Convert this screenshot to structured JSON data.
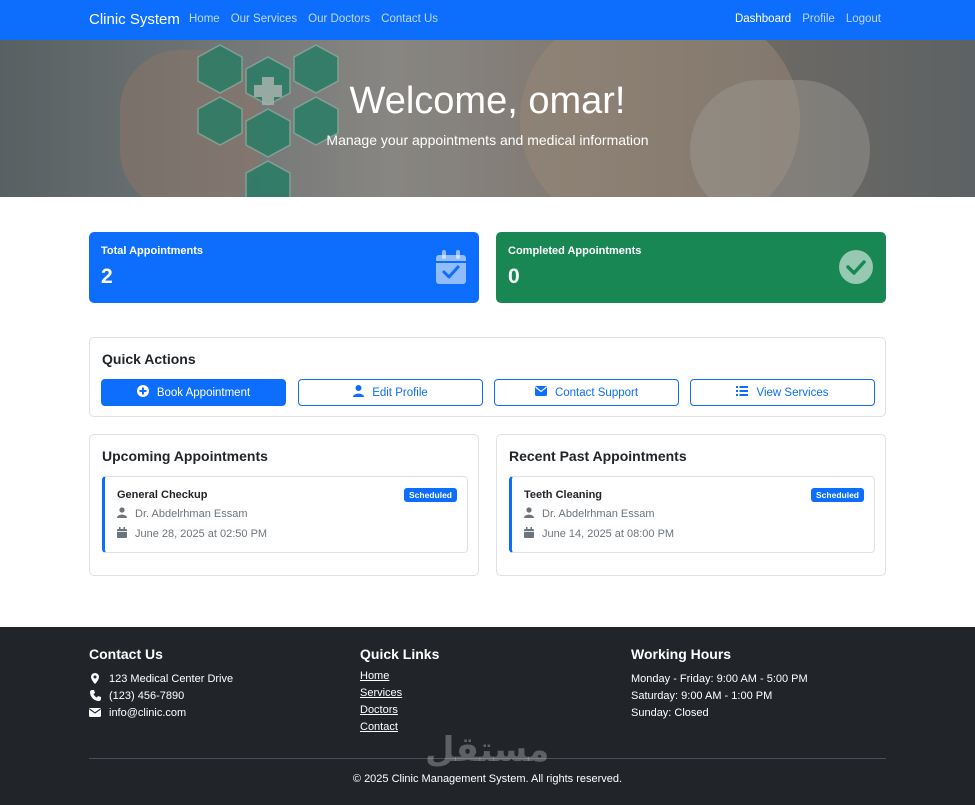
{
  "navbar": {
    "brand": "Clinic System",
    "left_links": [
      "Home",
      "Our Services",
      "Our Doctors",
      "Contact Us"
    ],
    "right_links": [
      "Dashboard",
      "Profile",
      "Logout"
    ],
    "active": "Dashboard"
  },
  "hero": {
    "title": "Welcome, omar!",
    "subtitle": "Manage your appointments and medical information"
  },
  "stats": {
    "total": {
      "label": "Total Appointments",
      "value": "2",
      "icon": "calendar-check-icon",
      "color": "#0d6efd"
    },
    "completed": {
      "label": "Completed Appointments",
      "value": "0",
      "icon": "check-circle-icon",
      "color": "#198754"
    }
  },
  "quick_actions": {
    "title": "Quick Actions",
    "buttons": [
      {
        "label": "Book Appointment",
        "icon": "plus-circle-icon"
      },
      {
        "label": "Edit Profile",
        "icon": "user-icon"
      },
      {
        "label": "Contact Support",
        "icon": "envelope-icon"
      },
      {
        "label": "View Services",
        "icon": "list-icon"
      }
    ]
  },
  "upcoming": {
    "title": "Upcoming Appointments",
    "items": [
      {
        "service": "General Checkup",
        "status": "Scheduled",
        "doctor": "Dr. Abdelrhman Essam",
        "datetime": "June 28, 2025 at 02:50 PM"
      }
    ]
  },
  "past": {
    "title": "Recent Past Appointments",
    "items": [
      {
        "service": "Teeth Cleaning",
        "status": "Scheduled",
        "doctor": "Dr. Abdelrhman Essam",
        "datetime": "June 14, 2025 at 08:00 PM"
      }
    ]
  },
  "footer": {
    "contact": {
      "title": "Contact Us",
      "address": "123 Medical Center Drive",
      "phone": "(123) 456-7890",
      "email": "info@clinic.com"
    },
    "links": {
      "title": "Quick Links",
      "items": [
        "Home",
        "Services",
        "Doctors",
        "Contact"
      ]
    },
    "hours": {
      "title": "Working Hours",
      "items": [
        "Monday - Friday: 9:00 AM - 5:00 PM",
        "Saturday: 9:00 AM - 1:00 PM",
        "Sunday: Closed"
      ]
    },
    "copyright": "© 2025 Clinic Management System. All rights reserved.",
    "watermark": "مستقل"
  }
}
